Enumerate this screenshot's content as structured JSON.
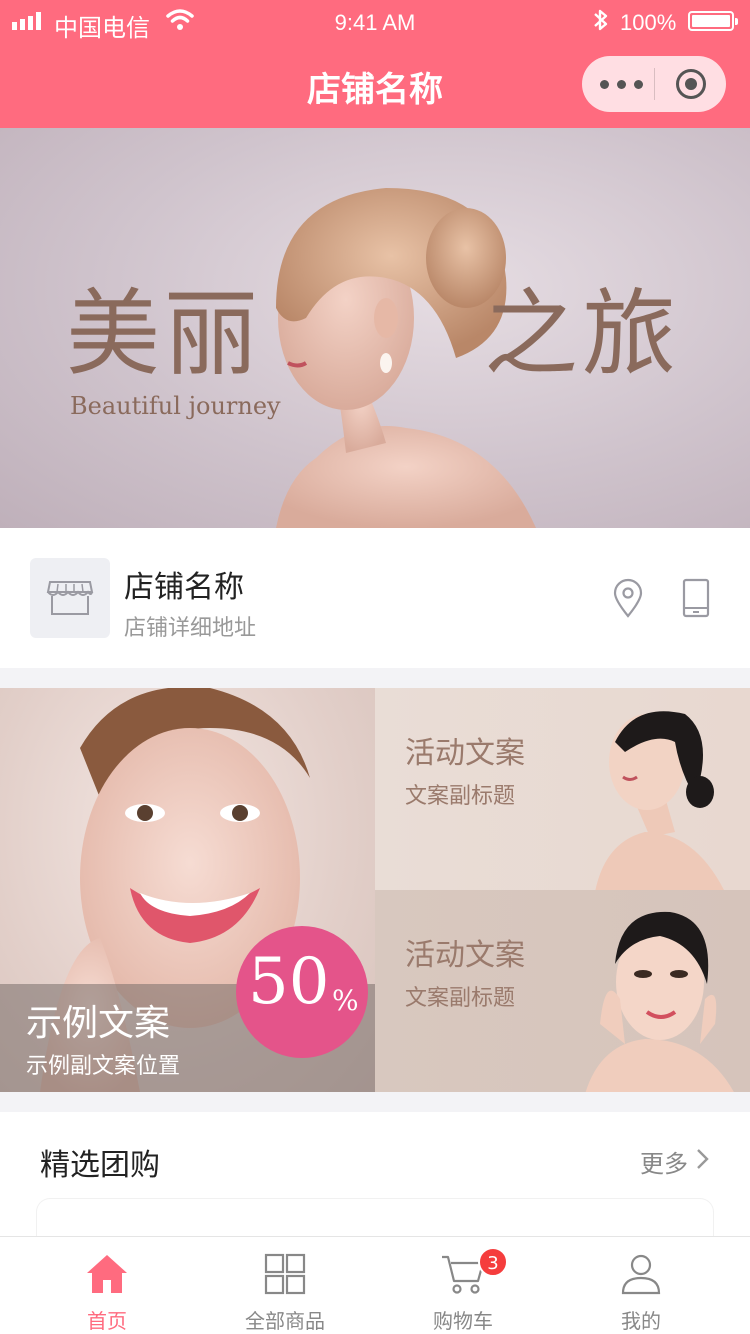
{
  "status_bar": {
    "carrier": "中国电信",
    "time": "9:41 AM",
    "battery": "100%"
  },
  "nav": {
    "title": "店铺名称",
    "icons": [
      "more-dots-icon",
      "target-icon"
    ]
  },
  "banner": {
    "heading_left": "美丽",
    "heading_right": "之旅",
    "subheading": "Beautiful journey"
  },
  "store": {
    "name": "店铺名称",
    "address": "店铺详细地址",
    "icons": [
      "storefront-icon",
      "location-pin-icon",
      "phone-icon"
    ]
  },
  "promo": {
    "main": {
      "title": "示例文案",
      "subtitle": "示例副文案位置",
      "discount_value": "50",
      "discount_unit": "%"
    },
    "side": [
      {
        "title": "活动文案",
        "subtitle": "文案副标题"
      },
      {
        "title": "活动文案",
        "subtitle": "文案副标题"
      }
    ]
  },
  "featured": {
    "title": "精选团购",
    "more": "更多"
  },
  "tab_bar": {
    "active_index": 0,
    "active_color": "#ff6b7f",
    "items": [
      {
        "label": "首页",
        "icon": "home-icon"
      },
      {
        "label": "全部商品",
        "icon": "grid-icon"
      },
      {
        "label": "购物车",
        "icon": "cart-icon",
        "badge": "3"
      },
      {
        "label": "我的",
        "icon": "user-icon"
      }
    ]
  },
  "colors": {
    "brand": "#ff6b7f",
    "discount": "#e4548a",
    "badge": "#f53d3d"
  }
}
